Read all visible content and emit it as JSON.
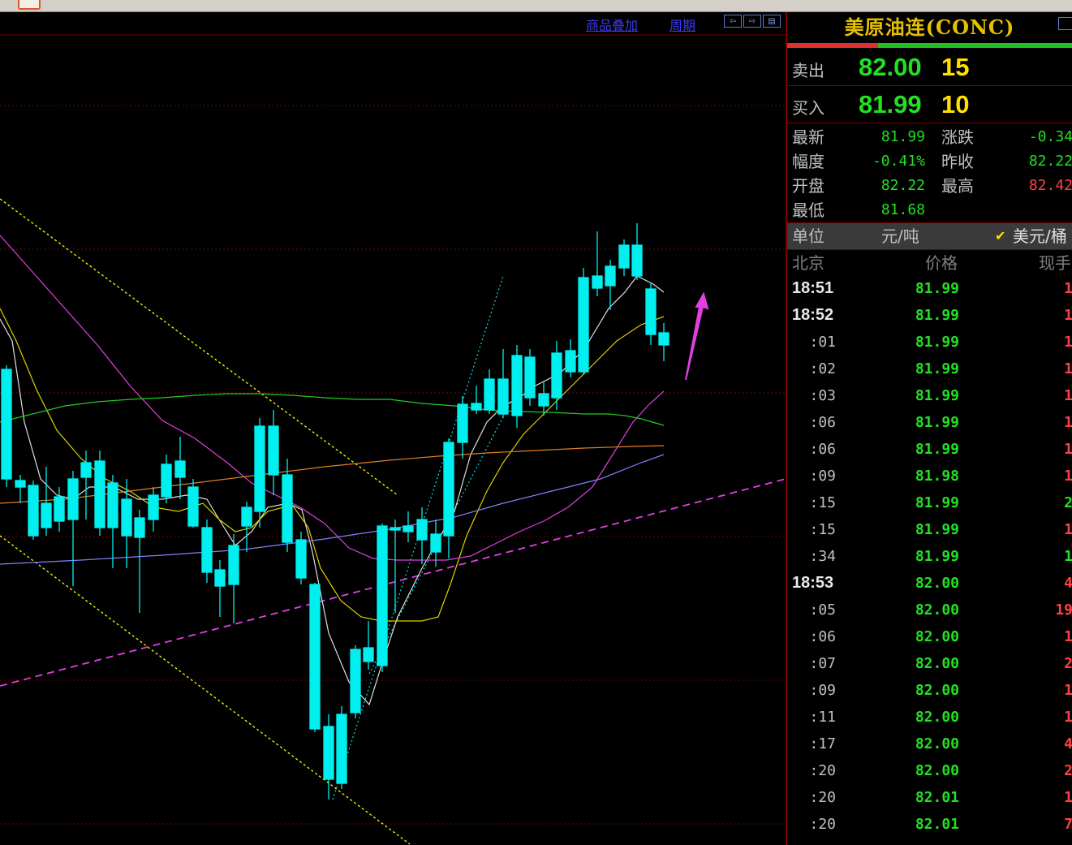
{
  "window": {
    "app_icon": "app-icon"
  },
  "chart": {
    "toolbar": {
      "overlay_label": "商品叠加",
      "period_label": "周期"
    },
    "grid_levels": [
      130,
      307,
      484,
      661,
      838,
      1015
    ],
    "colors": {
      "up": "#ff3c3c",
      "down": "#00f0f0",
      "ma5": "#e0e0e0",
      "ma10": "#e0d000",
      "ma20": "#e040e0",
      "ma60": "#22cc22",
      "ma120": "#e08020",
      "ma250": "#8080ff",
      "grid": "#800000",
      "channel": "#ffff00",
      "trend": "#e040e0"
    }
  },
  "panel": {
    "title": "美原油连(CONC)",
    "ratio_bar": {
      "sell_share": 0.32,
      "sell_color": "#e03030",
      "buy_color": "#22c022"
    },
    "sell": {
      "label": "卖出",
      "price": "82.00",
      "volume": "15"
    },
    "buy": {
      "label": "买入",
      "price": "81.99",
      "volume": "10"
    },
    "stats": [
      {
        "label": "最新",
        "value": "81.99",
        "color": "#22e022"
      },
      {
        "label": "涨跌",
        "value": "-0.34",
        "color": "#22e022"
      },
      {
        "label": "幅度",
        "value": "-0.41%",
        "color": "#22e022"
      },
      {
        "label": "昨收",
        "value": "82.22",
        "color": "#22e022"
      },
      {
        "label": "开盘",
        "value": "82.22",
        "color": "#22e022"
      },
      {
        "label": "最高",
        "value": "82.42",
        "color": "#ff4040"
      },
      {
        "label": "最低",
        "value": "81.68",
        "color": "#22e022"
      }
    ],
    "unit": {
      "label": "单位",
      "option1": "元/吨",
      "option2": "美元/桶",
      "selected": "美元/桶",
      "check": "✔"
    },
    "ticks_header": {
      "time": "北京",
      "price": "价格",
      "volume": "现手"
    },
    "ticks": [
      {
        "time": "18:51",
        "price": "81.99",
        "vol": "1",
        "pc": "#22e022",
        "vc": "#ff4040"
      },
      {
        "time": "18:52",
        "price": "81.99",
        "vol": "1",
        "pc": "#22e022",
        "vc": "#ff4040"
      },
      {
        "time": ":01",
        "price": "81.99",
        "vol": "1",
        "pc": "#22e022",
        "vc": "#ff4040"
      },
      {
        "time": ":02",
        "price": "81.99",
        "vol": "1",
        "pc": "#22e022",
        "vc": "#ff4040"
      },
      {
        "time": ":03",
        "price": "81.99",
        "vol": "1",
        "pc": "#22e022",
        "vc": "#ff4040"
      },
      {
        "time": ":06",
        "price": "81.99",
        "vol": "1",
        "pc": "#22e022",
        "vc": "#ff4040"
      },
      {
        "time": ":06",
        "price": "81.99",
        "vol": "1",
        "pc": "#22e022",
        "vc": "#ff4040"
      },
      {
        "time": ":09",
        "price": "81.98",
        "vol": "1",
        "pc": "#22e022",
        "vc": "#ff4040"
      },
      {
        "time": ":15",
        "price": "81.99",
        "vol": "2",
        "pc": "#22e022",
        "vc": "#22e022"
      },
      {
        "time": ":15",
        "price": "81.99",
        "vol": "1",
        "pc": "#22e022",
        "vc": "#ff4040"
      },
      {
        "time": ":34",
        "price": "81.99",
        "vol": "1",
        "pc": "#22e022",
        "vc": "#22e022"
      },
      {
        "time": "18:53",
        "price": "82.00",
        "vol": "4",
        "pc": "#22e022",
        "vc": "#ff4040"
      },
      {
        "time": ":05",
        "price": "82.00",
        "vol": "19",
        "pc": "#22e022",
        "vc": "#ff4040"
      },
      {
        "time": ":06",
        "price": "82.00",
        "vol": "1",
        "pc": "#22e022",
        "vc": "#ff4040"
      },
      {
        "time": ":07",
        "price": "82.00",
        "vol": "2",
        "pc": "#22e022",
        "vc": "#ff4040"
      },
      {
        "time": ":09",
        "price": "82.00",
        "vol": "1",
        "pc": "#22e022",
        "vc": "#ff4040"
      },
      {
        "time": ":11",
        "price": "82.00",
        "vol": "1",
        "pc": "#22e022",
        "vc": "#ff4040"
      },
      {
        "time": ":17",
        "price": "82.00",
        "vol": "4",
        "pc": "#22e022",
        "vc": "#ff4040"
      },
      {
        "time": ":20",
        "price": "82.00",
        "vol": "2",
        "pc": "#22e022",
        "vc": "#ff4040"
      },
      {
        "time": ":20",
        "price": "82.01",
        "vol": "1",
        "pc": "#22e022",
        "vc": "#ff4040"
      },
      {
        "time": ":20",
        "price": "82.01",
        "vol": "7",
        "pc": "#22e022",
        "vc": "#ff4040"
      }
    ]
  }
}
